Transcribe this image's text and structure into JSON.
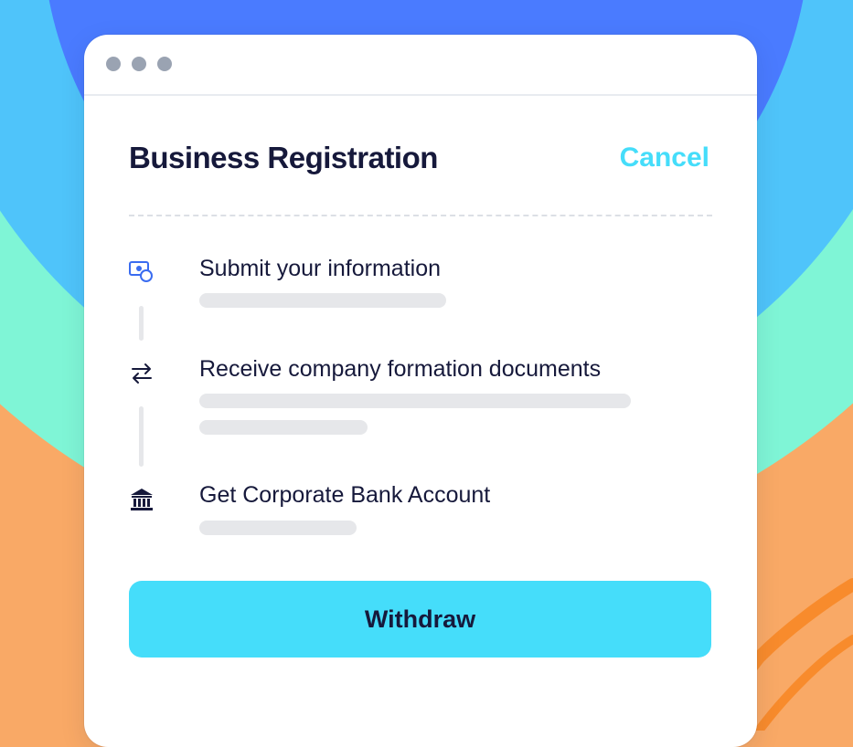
{
  "window": {
    "title": "Business Registration",
    "cancel_label": "Cancel"
  },
  "steps": [
    {
      "label": "Submit your information",
      "icon": "money-icon"
    },
    {
      "label": "Receive company formation documents",
      "icon": "swap-arrows-icon"
    },
    {
      "label": "Get Corporate Bank Account",
      "icon": "bank-icon"
    }
  ],
  "action": {
    "withdraw_label": "Withdraw"
  },
  "colors": {
    "accent": "#45ddfa",
    "text_dark": "#16193b",
    "bg_blue": "#4a7bff",
    "bg_sky": "#4fc4fa",
    "bg_mint": "#7ff5d6",
    "bg_orange": "#f9a966",
    "squiggle": "#f88b2c"
  }
}
